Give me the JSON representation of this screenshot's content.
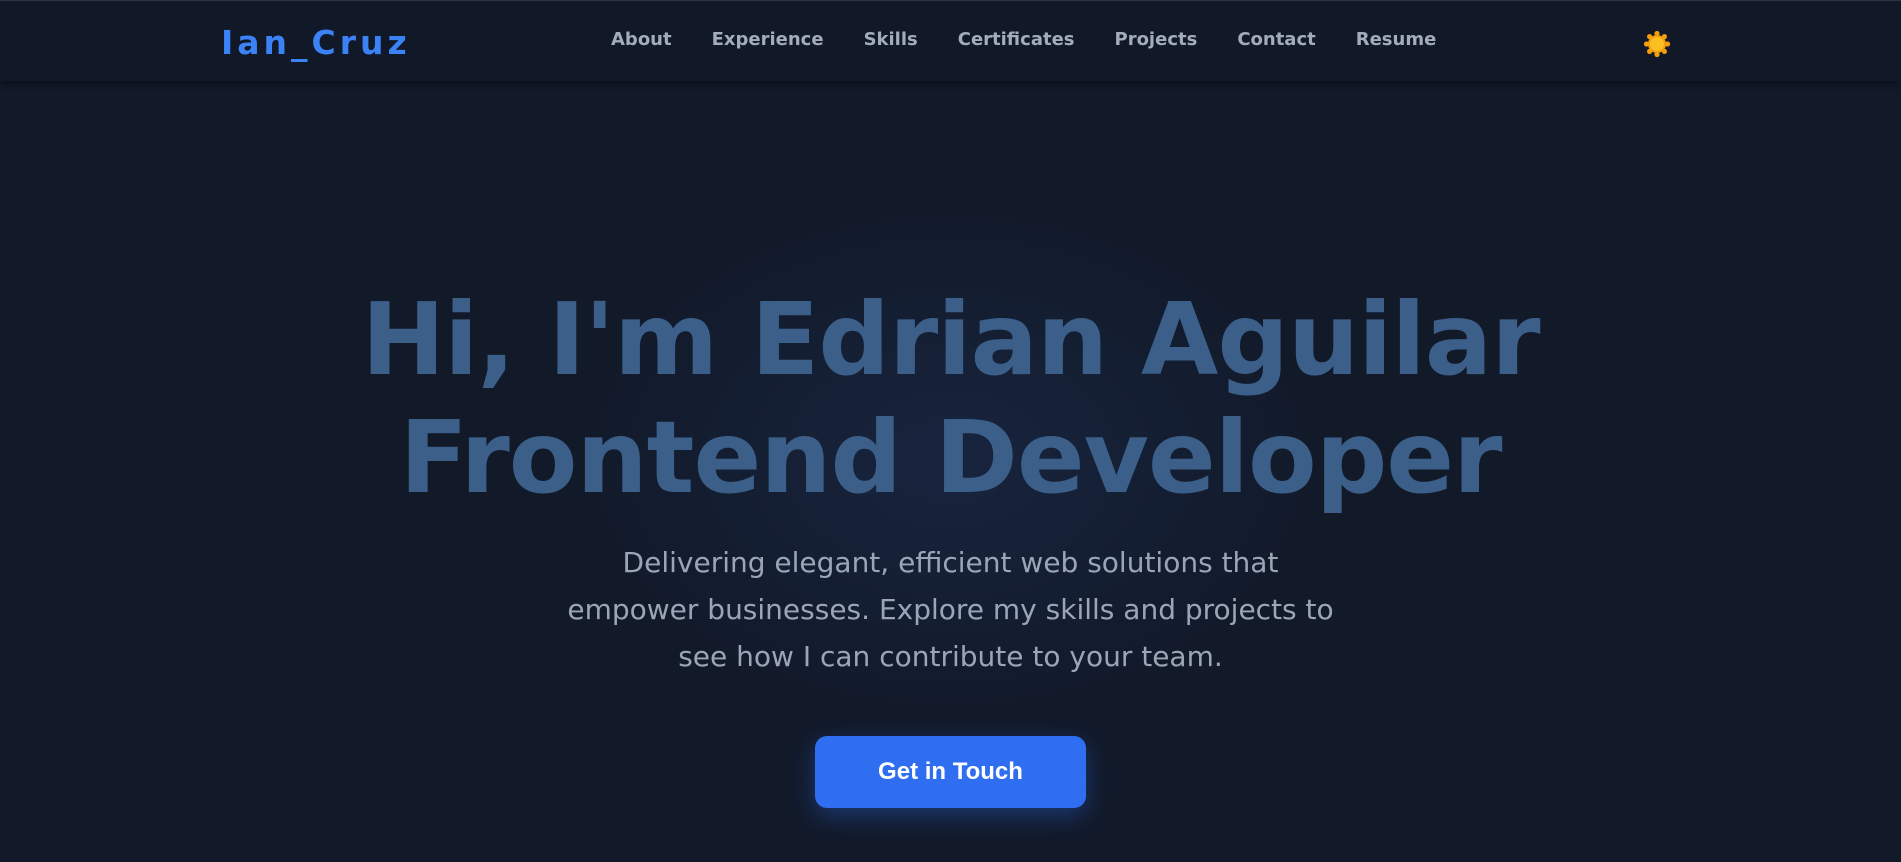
{
  "navbar": {
    "brand": "Ian_Cruz",
    "links": [
      {
        "label": "About"
      },
      {
        "label": "Experience"
      },
      {
        "label": "Skills"
      },
      {
        "label": "Certificates"
      },
      {
        "label": "Projects"
      },
      {
        "label": "Contact"
      },
      {
        "label": "Resume"
      }
    ],
    "theme_toggle_icon": "sun-icon"
  },
  "hero": {
    "title_line1": "Hi, I'm Edrian Aguilar",
    "title_line2": "Frontend Developer",
    "subtitle": "Delivering elegant, efficient web solutions that empower businesses. Explore my skills and projects to see how I can contribute to your team.",
    "cta_label": "Get in Touch"
  },
  "colors": {
    "background": "#121a2a",
    "navbar_background": "#111827",
    "brand": "#3b82f6",
    "nav_link": "#a3acbb",
    "hero_title": "#3b5f89",
    "subtitle": "#9aa6b6",
    "cta_background": "#2f6ef0",
    "sun": "#f5a524"
  }
}
